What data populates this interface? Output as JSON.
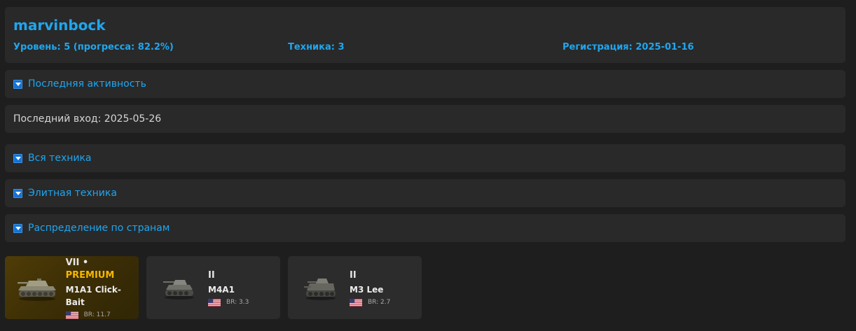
{
  "profile": {
    "username": "marvinbock",
    "level": "Уровень: 5 (прогресса: 82.2%)",
    "vehicles": "Техника: 3",
    "registered": "Регистрация: 2025-01-16"
  },
  "sections": [
    {
      "label": "Последняя активность",
      "icon": "collapse-arrow-icon"
    },
    {
      "label": "Вся техника",
      "icon": "collapse-arrow-icon"
    },
    {
      "label": "Элитная техника",
      "icon": "collapse-arrow-icon"
    },
    {
      "label": "Распределение по странам",
      "icon": "collapse-arrow-icon"
    }
  ],
  "activity": {
    "last_login": "Последний вход: 2025-05-26"
  },
  "vehicle_cards": [
    {
      "tier": "VII",
      "separator": " • ",
      "badge": "PREMIUM",
      "name": "M1A1 Click-Bait",
      "br": "BR: 11.7",
      "flag": "usa-flag-icon",
      "image": "abrams-tank-icon"
    },
    {
      "tier": "II",
      "name": "M4A1",
      "br": "BR: 3.3",
      "flag": "usa-flag-icon",
      "image": "sherman-tank-icon"
    },
    {
      "tier": "II",
      "name": "M3 Lee",
      "br": "BR: 2.7",
      "flag": "usa-flag-icon",
      "image": "lee-tank-icon"
    }
  ],
  "colors": {
    "accent": "#1fa6ef",
    "premium": "#f5b800",
    "panel": "#292929",
    "background": "#1e1e1e"
  }
}
